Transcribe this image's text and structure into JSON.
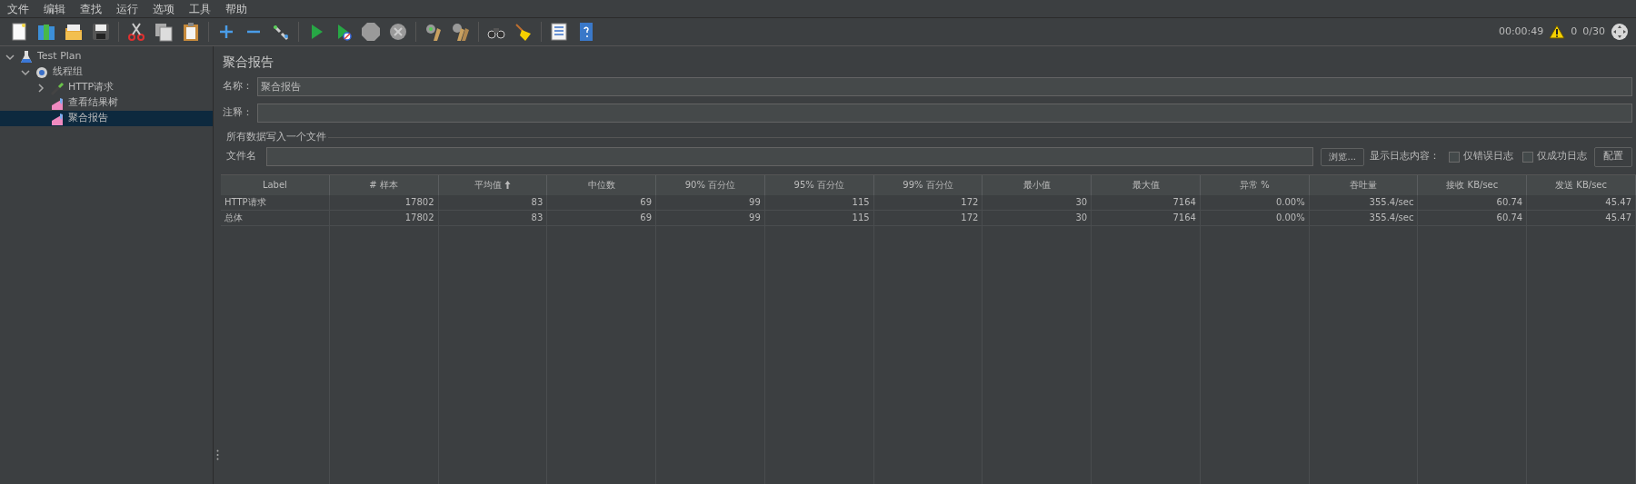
{
  "menu": [
    "文件",
    "编辑",
    "查找",
    "运行",
    "选项",
    "工具",
    "帮助"
  ],
  "status": {
    "elapsed": "00:00:49",
    "warnings": "0",
    "threads": "0/30"
  },
  "tree": [
    {
      "label": "Test Plan",
      "kind": "plan",
      "expanded": true,
      "selected": false,
      "children": [
        {
          "label": "线程组",
          "kind": "threads",
          "expanded": true,
          "selected": false,
          "children": [
            {
              "label": "HTTP请求",
              "kind": "sampler",
              "expanded": false,
              "selected": false
            },
            {
              "label": "查看结果树",
              "kind": "listener",
              "selected": false
            },
            {
              "label": "聚合报告",
              "kind": "listener",
              "selected": true
            }
          ]
        }
      ]
    }
  ],
  "panel": {
    "title": "聚合报告",
    "name_label": "名称：",
    "name_value": "聚合报告",
    "comment_label": "注释：",
    "group_title": "所有数据写入一个文件",
    "file_label": "文件名",
    "browse_button": "浏览...",
    "log_label": "显示日志内容：",
    "checkboxes": [
      {
        "label": "仅错误日志",
        "checked": false
      },
      {
        "label": "仅成功日志",
        "checked": false
      }
    ],
    "config_button": "配置"
  },
  "table": {
    "columns": [
      {
        "label": "Label",
        "sorted": false
      },
      {
        "label": "# 样本",
        "sorted": false
      },
      {
        "label": "平均值",
        "sorted": true
      },
      {
        "label": "中位数",
        "sorted": false
      },
      {
        "label": "90% 百分位",
        "sorted": false
      },
      {
        "label": "95% 百分位",
        "sorted": false
      },
      {
        "label": "99% 百分位",
        "sorted": false
      },
      {
        "label": "最小值",
        "sorted": false
      },
      {
        "label": "最大值",
        "sorted": false
      },
      {
        "label": "异常 %",
        "sorted": false
      },
      {
        "label": "吞吐量",
        "sorted": false
      },
      {
        "label": "接收 KB/sec",
        "sorted": false
      },
      {
        "label": "发送 KB/sec",
        "sorted": false
      }
    ],
    "rows": [
      [
        "HTTP请求",
        "17802",
        "83",
        "69",
        "99",
        "115",
        "172",
        "30",
        "7164",
        "0.00%",
        "355.4/sec",
        "60.74",
        "45.47"
      ],
      [
        "总体",
        "17802",
        "83",
        "69",
        "99",
        "115",
        "172",
        "30",
        "7164",
        "0.00%",
        "355.4/sec",
        "60.74",
        "45.47"
      ]
    ]
  }
}
